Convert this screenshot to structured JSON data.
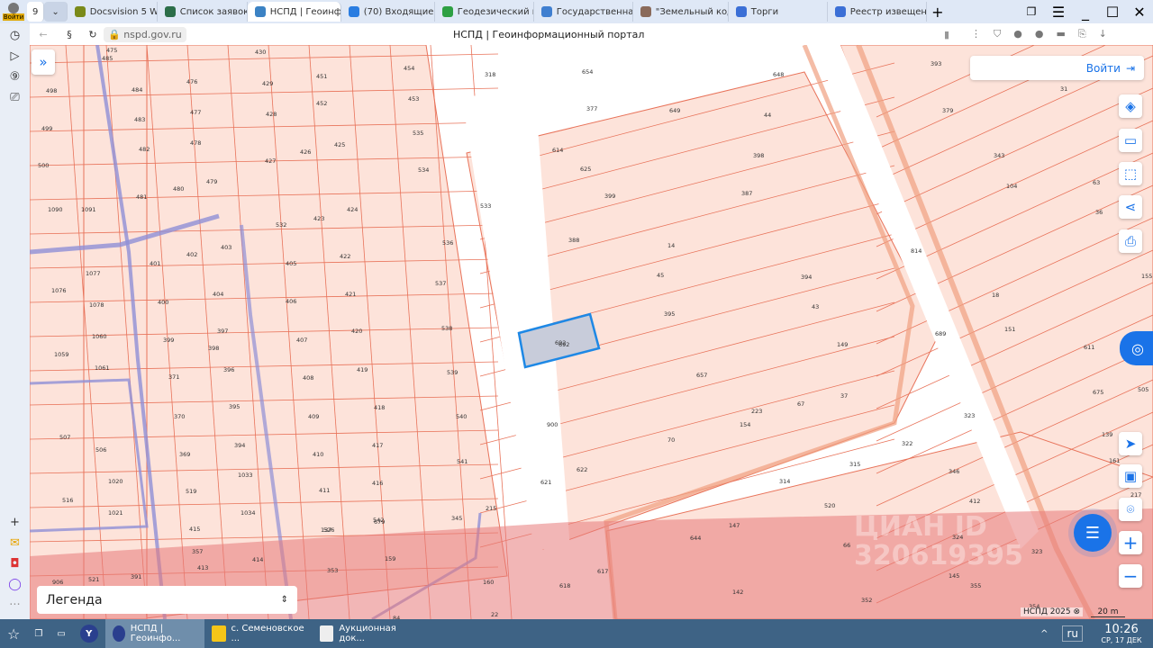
{
  "browser": {
    "profile_label": "Войти",
    "tab_count": "9",
    "tabs": [
      {
        "title": "Docsvision 5 Web-кл",
        "color": "#7a8a1a"
      },
      {
        "title": "Список заявок — Те",
        "color": "#2c6e49"
      },
      {
        "title": "НСПД | Геоинфор",
        "color": "#3b82c4",
        "active": true
      },
      {
        "title": "(70) Входящие - По",
        "color": "#2a7de1"
      },
      {
        "title": "Геодезический кал",
        "color": "#2ea043"
      },
      {
        "title": "Государственная и",
        "color": "#3f7fd0"
      },
      {
        "title": "\"Земельный кодекс",
        "color": "#8a6a5a"
      },
      {
        "title": "Торги",
        "color": "#3b6fd6"
      },
      {
        "title": "Реестр извещений",
        "color": "#3b6fd6"
      }
    ],
    "url": "nspd.gov.ru",
    "page_title": "НСПД | Геоинформационный портал"
  },
  "map": {
    "login_label": "Войти",
    "legend_label": "Легенда",
    "copyright": "НСПД 2025",
    "scale": "20 m",
    "watermark": "ЦИАН ID 320619395",
    "selected_parcel": "692",
    "colors": {
      "parcel_fill": "#fde3da",
      "parcel_line": "#e8735a",
      "zone": "#e77a7a",
      "selected": "#1e88e5",
      "boundary": "#8e8fd6"
    },
    "parcels": [
      "475",
      "485",
      "430",
      "454",
      "654",
      "648",
      "393",
      "498",
      "484",
      "476",
      "429",
      "451",
      "453",
      "318",
      "377",
      "649",
      "44",
      "31",
      "499",
      "483",
      "477",
      "428",
      "452",
      "535",
      "614",
      "625",
      "398",
      "379",
      "343",
      "500",
      "482",
      "478",
      "427",
      "426",
      "425",
      "534",
      "399",
      "387",
      "104",
      "63",
      "1090",
      "1091",
      "481",
      "480",
      "479",
      "533",
      "388",
      "14",
      "36",
      "532",
      "423",
      "424",
      "401",
      "402",
      "403",
      "1077",
      "536",
      "45",
      "394",
      "814",
      "155",
      "1076",
      "1078",
      "400",
      "404",
      "405",
      "422",
      "537",
      "43",
      "18",
      "406",
      "421",
      "395",
      "151",
      "1060",
      "399",
      "397",
      "407",
      "420",
      "538",
      "692",
      "149",
      "689",
      "611",
      "1059",
      "398",
      "396",
      "408",
      "419",
      "539",
      "657",
      "37",
      "675",
      "1061",
      "371",
      "370",
      "395",
      "409",
      "418",
      "540",
      "223",
      "67",
      "323",
      "505",
      "507",
      "506",
      "369",
      "394",
      "410",
      "417",
      "900",
      "70",
      "154",
      "322",
      "139",
      "161",
      "541",
      "622",
      "315",
      "346",
      "1020",
      "1033",
      "519",
      "411",
      "416",
      "621",
      "314",
      "162",
      "516",
      "1021",
      "1034",
      "526",
      "542",
      "345",
      "215",
      "520",
      "412",
      "415",
      "137",
      "679",
      "147",
      "217",
      "644",
      "357",
      "66",
      "324",
      "323",
      "906",
      "521",
      "391",
      "413",
      "414",
      "353",
      "159",
      "160",
      "618",
      "617",
      "145",
      "355",
      "142",
      "352",
      "354",
      "84",
      "22"
    ],
    "controls": [
      "layers",
      "ruler",
      "select-area",
      "share",
      "print",
      "geolocate",
      "map-type",
      "locate-parcel",
      "zoom-in",
      "zoom-out"
    ]
  },
  "taskbar": {
    "items": [
      {
        "title": "НСПД | Геоинфо..."
      },
      {
        "title": "с. Семеновское ..."
      },
      {
        "title": "Аукционная док..."
      }
    ],
    "lang": "ru",
    "time": "10:26",
    "date": "СР, 17 ДЕК"
  }
}
